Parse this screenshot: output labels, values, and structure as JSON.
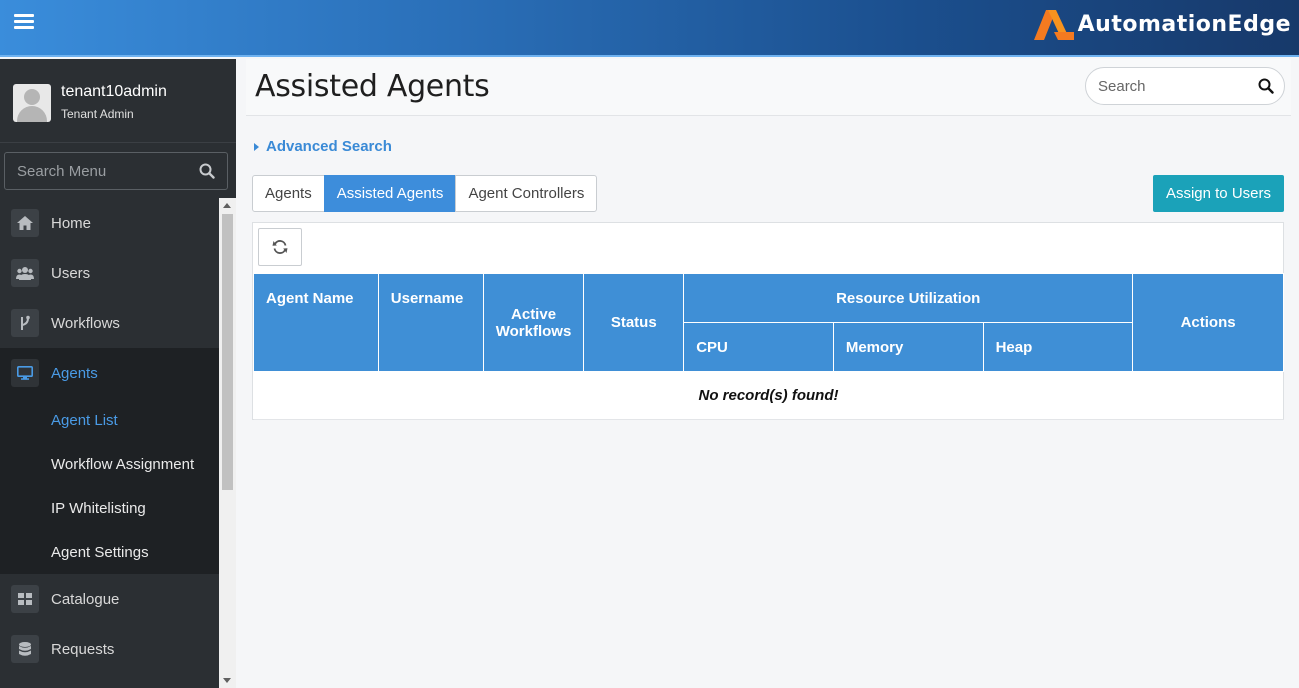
{
  "brand": {
    "name": "AutomationEdge",
    "accent": "#f47a20",
    "topbar_color": "#2a6fb8"
  },
  "user": {
    "name": "tenant10admin",
    "role": "Tenant Admin"
  },
  "sidebar": {
    "search_placeholder": "Search Menu",
    "items": [
      {
        "label": "Home",
        "icon": "home-icon"
      },
      {
        "label": "Users",
        "icon": "users-icon"
      },
      {
        "label": "Workflows",
        "icon": "workflow-icon"
      },
      {
        "label": "Agents",
        "icon": "monitor-icon",
        "active": true
      },
      {
        "label": "Catalogue",
        "icon": "grid-icon"
      },
      {
        "label": "Requests",
        "icon": "database-icon"
      }
    ],
    "agents_submenu": [
      {
        "label": "Agent List",
        "active": true
      },
      {
        "label": "Workflow Assignment"
      },
      {
        "label": "IP Whitelisting"
      },
      {
        "label": "Agent Settings"
      }
    ]
  },
  "page": {
    "title": "Assisted Agents",
    "search_placeholder": "Search",
    "advanced_search": "Advanced Search",
    "tabs": [
      {
        "label": "Agents"
      },
      {
        "label": "Assisted Agents",
        "active": true
      },
      {
        "label": "Agent Controllers"
      }
    ],
    "assign_button": "Assign to Users"
  },
  "table": {
    "columns": {
      "agent_name": "Agent Name",
      "username": "Username",
      "active_workflows": "Active Workflows",
      "status": "Status",
      "resource_utilization": "Resource Utilization",
      "cpu": "CPU",
      "memory": "Memory",
      "heap": "Heap",
      "actions": "Actions"
    },
    "empty_message": "No record(s) found!",
    "header_color": "#3f8fd6"
  }
}
